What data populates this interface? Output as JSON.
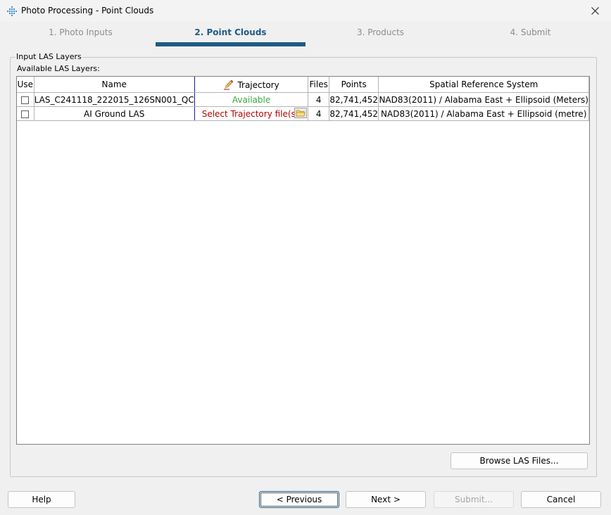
{
  "window": {
    "title": "Photo Processing - Point Clouds"
  },
  "steps": [
    {
      "label": "1.  Photo Inputs"
    },
    {
      "label": "2.  Point Clouds"
    },
    {
      "label": "3.  Products"
    },
    {
      "label": "4.  Submit"
    }
  ],
  "group": {
    "title": "Input LAS Layers",
    "available_label": "Available LAS Layers:"
  },
  "grid": {
    "headers": {
      "use": "Use",
      "name": "Name",
      "trajectory": "Trajectory",
      "files": "Files",
      "points": "Points",
      "srs": "Spatial Reference System"
    },
    "rows": [
      {
        "name": "LAS_C241118_222015_126SN001_QC",
        "trajectory": "Available",
        "files": "4",
        "points": "82,741,452",
        "srs": "NAD83(2011) / Alabama East + Ellipsoid (Meters)"
      },
      {
        "name": "AI Ground LAS",
        "trajectory": "Select Trajectory file(s)...",
        "files": "4",
        "points": "82,741,452",
        "srs": "NAD83(2011) / Alabama East + Ellipsoid (metre)"
      }
    ]
  },
  "buttons": {
    "browse": "Browse LAS Files...",
    "help": "Help",
    "previous": "< Previous",
    "next": "Next >",
    "submit": "Submit...",
    "cancel": "Cancel"
  },
  "colors": {
    "accent": "#1e5b86",
    "available": "#3aa83a",
    "missing": "#b40000"
  }
}
